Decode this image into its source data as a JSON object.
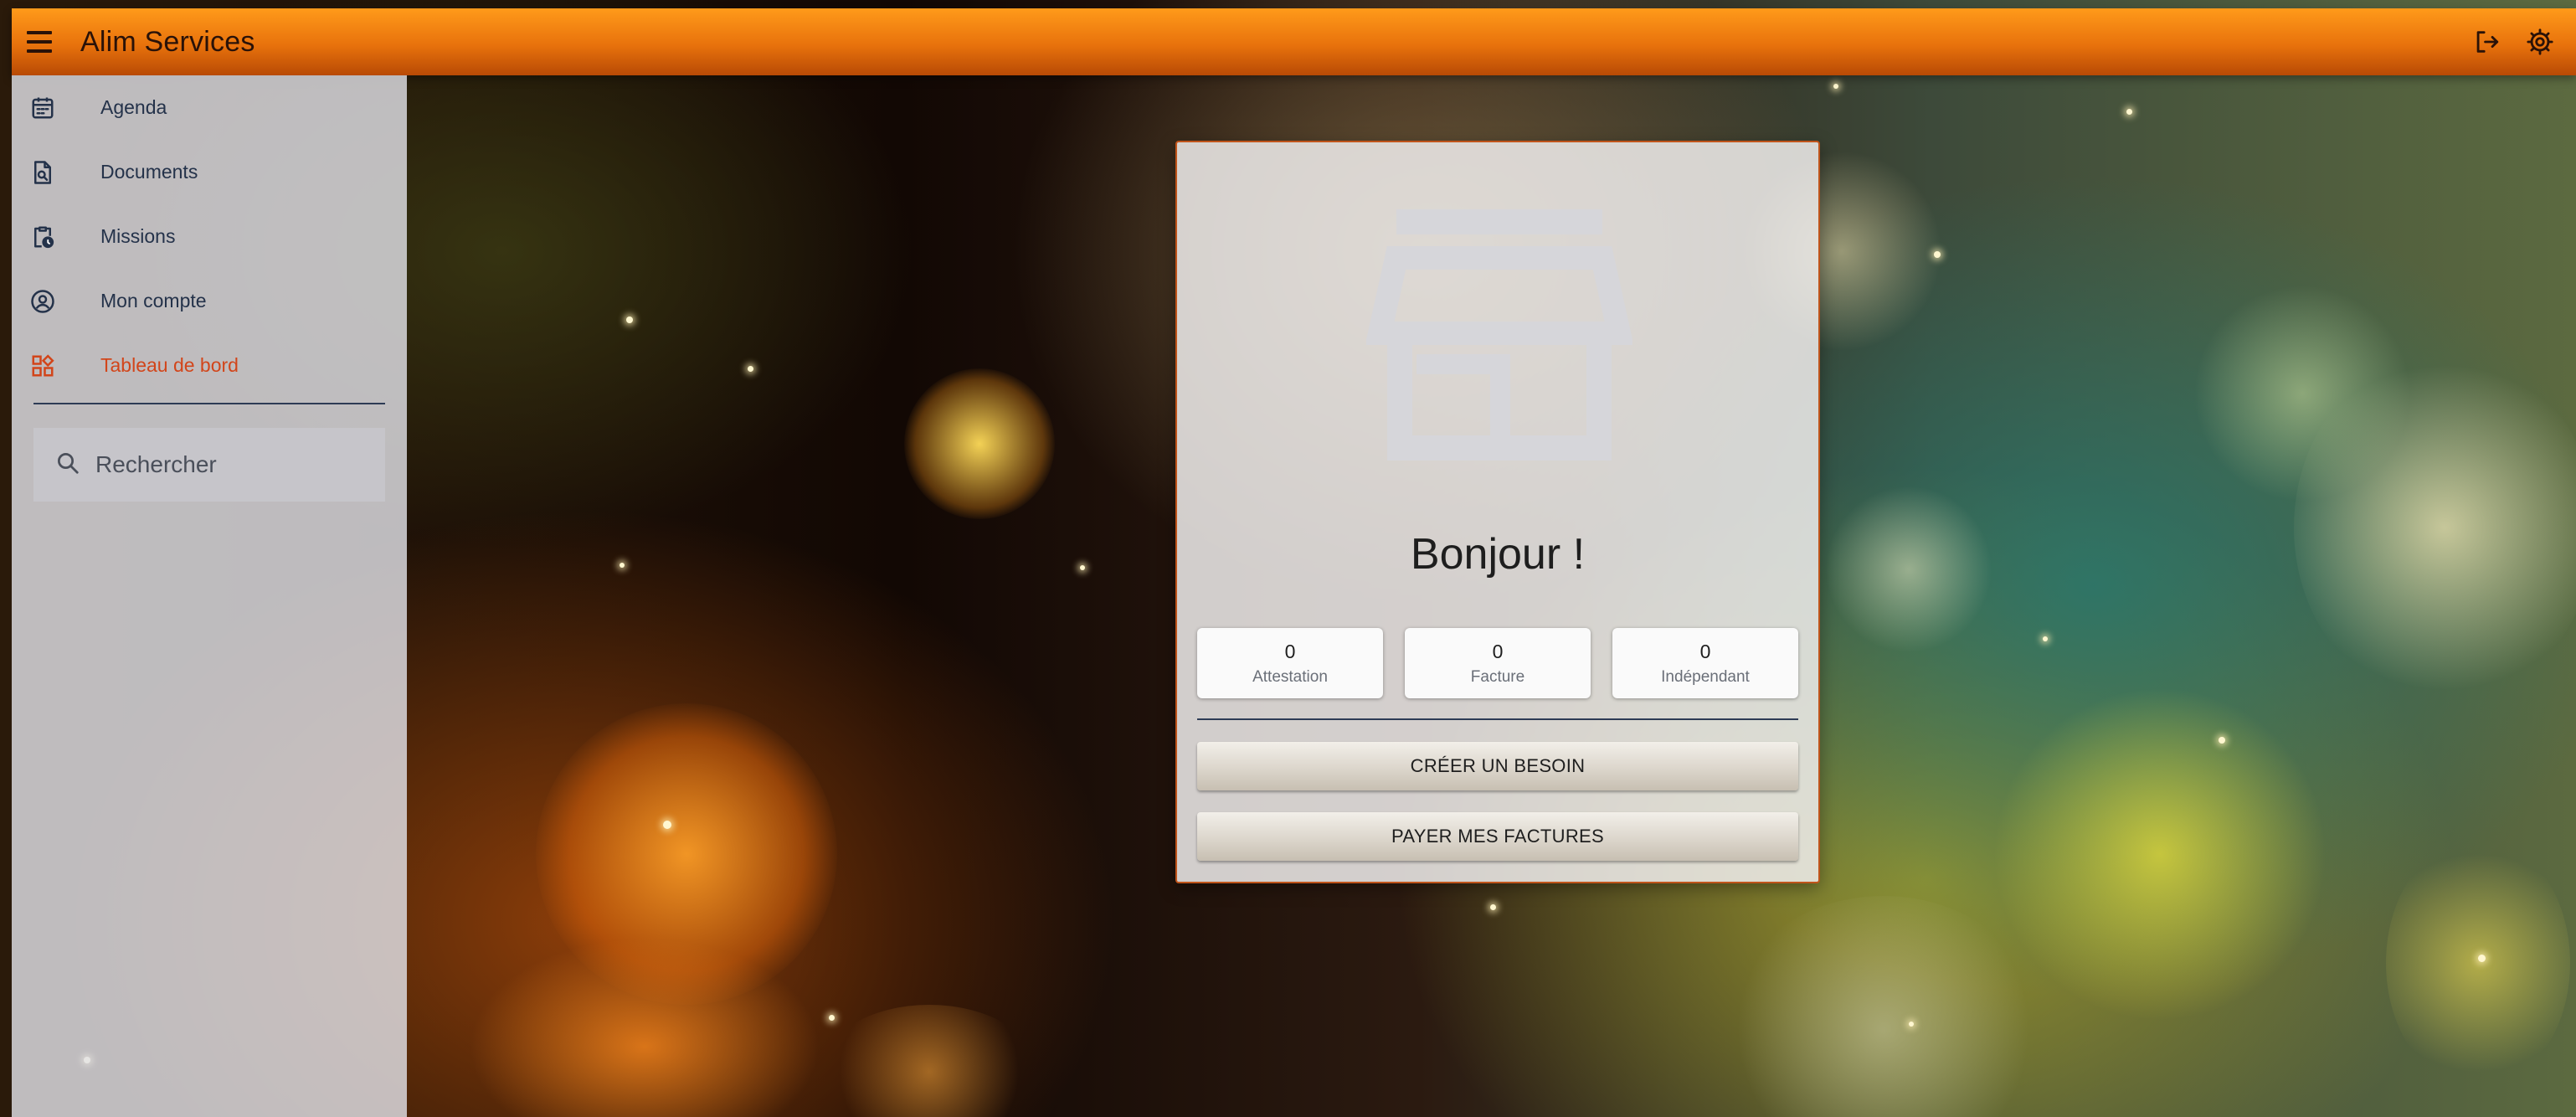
{
  "app": {
    "title": "Alim Services"
  },
  "header": {
    "menu_icon": "menu-icon",
    "logout_icon": "logout-icon",
    "settings_icon": "settings-gear-icon"
  },
  "sidebar": {
    "items": [
      {
        "label": "Agenda",
        "icon": "calendar-icon",
        "active": false
      },
      {
        "label": "Documents",
        "icon": "document-search-icon",
        "active": false
      },
      {
        "label": "Missions",
        "icon": "clipboard-clock-icon",
        "active": false
      },
      {
        "label": "Mon compte",
        "icon": "account-circle-icon",
        "active": false
      },
      {
        "label": "Tableau de bord",
        "icon": "dashboard-icon",
        "active": true
      }
    ],
    "search": {
      "placeholder": "Rechercher",
      "value": ""
    }
  },
  "main": {
    "greeting": "Bonjour !",
    "stats": [
      {
        "value": "0",
        "label": "Attestation"
      },
      {
        "value": "0",
        "label": "Facture"
      },
      {
        "value": "0",
        "label": "Indépendant"
      }
    ],
    "actions": {
      "create_need": "CRÉER UN BESOIN",
      "pay_invoices": "PAYER MES FACTURES"
    }
  },
  "colors": {
    "appbar": "#e8720c",
    "accent_active": "#d2451a",
    "text_dark": "#24324a"
  }
}
